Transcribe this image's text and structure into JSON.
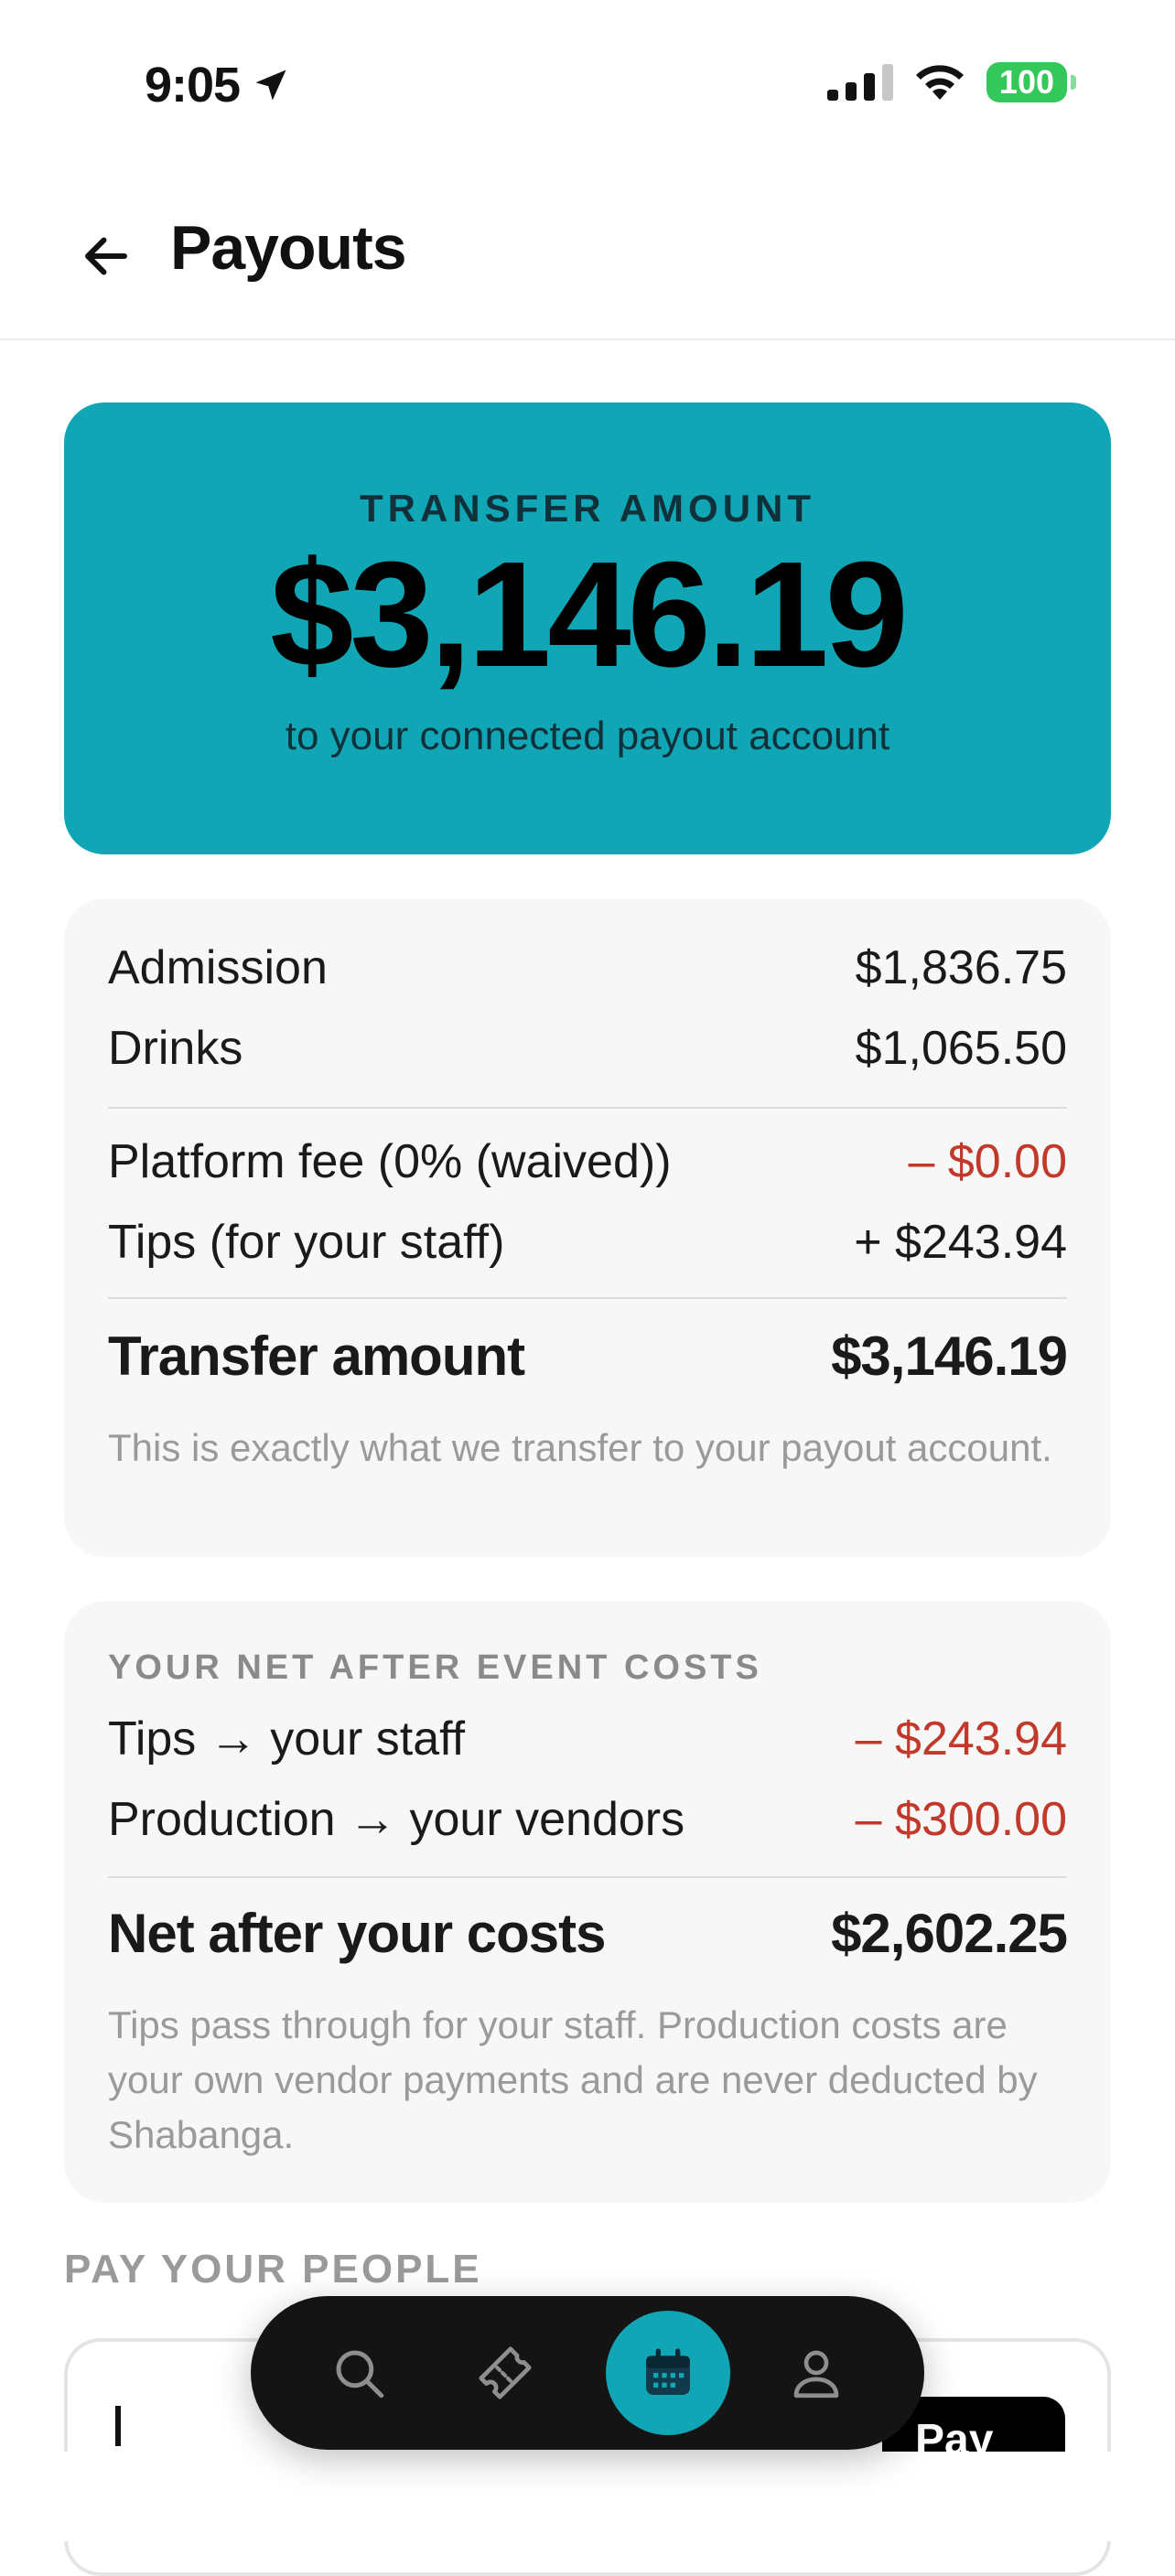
{
  "status_bar": {
    "time": "9:05",
    "battery": "100",
    "colors": {
      "battery": "#34c759"
    }
  },
  "header": {
    "title": "Payouts",
    "back_icon": "arrow-left-icon"
  },
  "hero": {
    "label": "TRANSFER AMOUNT",
    "amount": "$3,146.19",
    "subtitle": "to your connected payout account",
    "color": "#11a6b6"
  },
  "breakdown": {
    "rows": [
      {
        "label": "Admission",
        "value": "$1,836.75"
      },
      {
        "label": "Drinks",
        "value": "$1,065.50"
      },
      {
        "label": "Platform fee (0% (waived))",
        "value": "– $0.00"
      },
      {
        "label": "Tips (for your staff)",
        "value": "+ $243.94"
      }
    ],
    "total_label": "Transfer amount",
    "total_value": "$3,146.19",
    "note": "This is exactly what we transfer to your payout account."
  },
  "net": {
    "heading": "YOUR NET AFTER EVENT COSTS",
    "rows": [
      {
        "label": "Tips → your staff",
        "value": "– $243.94"
      },
      {
        "label": "Production → your vendors",
        "value": "– $300.00"
      }
    ],
    "total_label": "Net after your costs",
    "total_value": "$2,602.25",
    "note": "Tips pass through for your staff. Production costs are your own vendor payments and are never deducted by Shabanga."
  },
  "pay_people": {
    "heading": "PAY YOUR PEOPLE",
    "button_label": "Pay"
  },
  "tab_bar": {
    "tabs": [
      {
        "icon": "search-icon"
      },
      {
        "icon": "ticket-icon"
      },
      {
        "icon": "calendar-icon",
        "active": true
      },
      {
        "icon": "profile-icon"
      }
    ],
    "active_color": "#11a6b6"
  },
  "colors": {
    "negative": "#c0392b"
  }
}
